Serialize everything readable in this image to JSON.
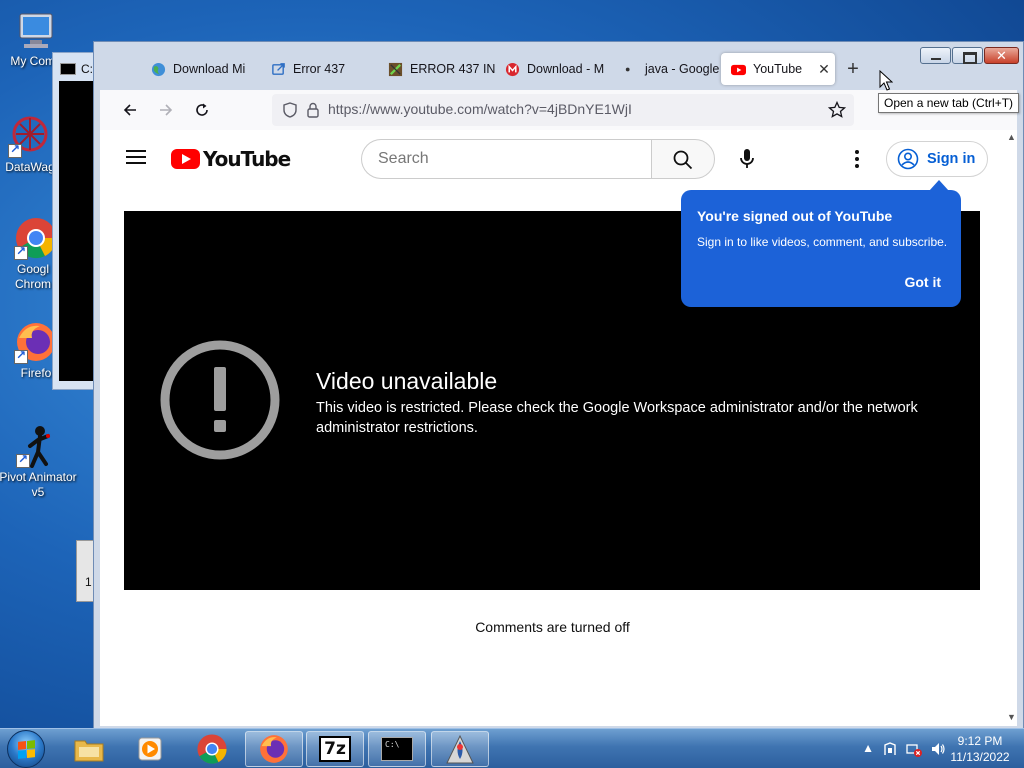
{
  "desktop": {
    "icons": [
      {
        "label": "My Comp"
      },
      {
        "label": "DataWag"
      },
      {
        "label": "Googl Chrom"
      },
      {
        "label": "Firefo"
      },
      {
        "label": "Pivot Animator v5"
      }
    ],
    "bg_window_title": "C:",
    "bg_window2_text": "1"
  },
  "browser": {
    "tabs": [
      {
        "label": "Download Mi",
        "icon": "globe-icon"
      },
      {
        "label": "Error 437",
        "icon": "share-icon"
      },
      {
        "label": "ERROR 437 IN",
        "icon": "minecraft-icon"
      },
      {
        "label": "Download - M",
        "icon": "mega-icon"
      },
      {
        "label": "java - Google",
        "icon": "dot-icon"
      },
      {
        "label": "YouTube",
        "icon": "youtube-icon",
        "active": true
      }
    ],
    "tab_close": "✕",
    "new_tab": "+",
    "tooltip": "Open a new tab (Ctrl+T)",
    "url": "https://www.youtube.com/watch?v=4jBDnYE1WjI"
  },
  "youtube": {
    "logo_text": "YouTube",
    "search_placeholder": "Search",
    "sign_in": "Sign in",
    "popup": {
      "title": "You're signed out of YouTube",
      "body": "Sign in to like videos, comment, and subscribe.",
      "button": "Got it"
    },
    "player": {
      "title": "Video unavailable",
      "message": "This video is restricted. Please check the Google Workspace administrator and/or the network administrator restrictions."
    },
    "comments": "Comments are turned off"
  },
  "taskbar": {
    "apps": [
      "file-explorer",
      "media-player",
      "chrome",
      "firefox",
      "7zip",
      "cmd",
      "java"
    ],
    "seven_zip_label": "7z",
    "cmd_label": "C:\\",
    "time": "9:12 PM",
    "date": "11/13/2022"
  },
  "colors": {
    "youtube_red": "#ff0000",
    "link_blue": "#065fd4",
    "popup_blue": "#1c62d8"
  }
}
